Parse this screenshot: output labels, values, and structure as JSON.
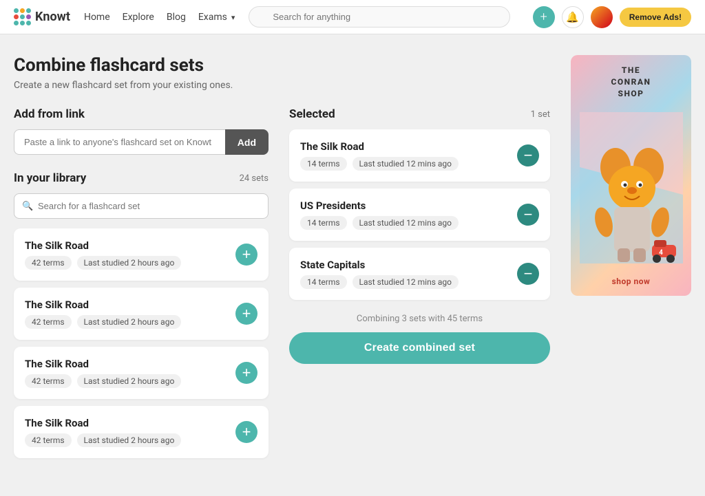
{
  "nav": {
    "logo_text": "Knowt",
    "links": [
      {
        "label": "Home",
        "id": "home"
      },
      {
        "label": "Explore",
        "id": "explore"
      },
      {
        "label": "Blog",
        "id": "blog"
      },
      {
        "label": "Exams",
        "id": "exams",
        "dropdown": true
      }
    ],
    "search_placeholder": "Search for anything",
    "remove_ads_label": "Remove Ads!"
  },
  "page": {
    "title": "Combine flashcard sets",
    "subtitle": "Create a new flashcard set from your existing ones.",
    "add_from_link": {
      "section_title": "Add from link",
      "input_placeholder": "Paste a link to anyone's flashcard set on Knowt",
      "add_button_label": "Add"
    },
    "library": {
      "section_title": "In your library",
      "set_count": "24 sets",
      "search_placeholder": "Search for a flashcard set",
      "cards": [
        {
          "name": "The Silk Road",
          "terms": "42 terms",
          "last_studied": "Last studied 2 hours ago"
        },
        {
          "name": "The Silk Road",
          "terms": "42 terms",
          "last_studied": "Last studied 2 hours ago"
        },
        {
          "name": "The Silk Road",
          "terms": "42 terms",
          "last_studied": "Last studied 2 hours ago"
        },
        {
          "name": "The Silk Road",
          "terms": "42 terms",
          "last_studied": "Last studied 2 hours ago"
        }
      ]
    },
    "selected": {
      "section_title": "Selected",
      "set_count": "1 set",
      "cards": [
        {
          "name": "The Silk Road",
          "terms": "14 terms",
          "last_studied": "Last studied 12 mins ago"
        },
        {
          "name": "US Presidents",
          "terms": "14 terms",
          "last_studied": "Last studied 12 mins ago"
        },
        {
          "name": "State Capitals",
          "terms": "14 terms",
          "last_studied": "Last studied 12 mins ago"
        }
      ],
      "combine_info": "Combining 3 sets with 45 terms",
      "create_button_label": "Create combined set"
    }
  },
  "ad": {
    "title": "THE\nCONRAN\nSHOP",
    "shop_now": "shop now"
  }
}
